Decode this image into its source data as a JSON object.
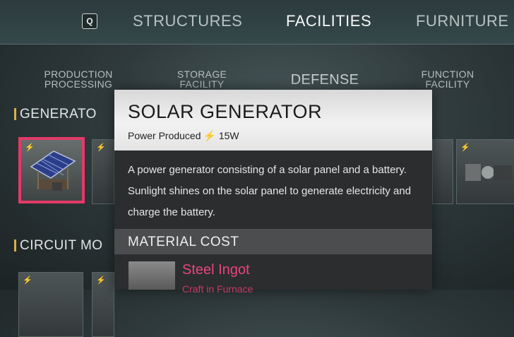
{
  "hotkey": "Q",
  "tabs": [
    {
      "label": "STRUCTURES"
    },
    {
      "label": "FACILITIES"
    },
    {
      "label": "FURNITURE"
    }
  ],
  "subtabs": [
    {
      "line1": "PRODUCTION",
      "line2": "PROCESSING"
    },
    {
      "line1": "STORAGE",
      "line2": "FACILITY"
    },
    {
      "label": "DEFENSE"
    },
    {
      "line1": "FUNCTION",
      "line2": "FACILITY"
    }
  ],
  "sections": {
    "generators": "GENERATO",
    "circuit": "CIRCUIT MO"
  },
  "popup": {
    "title": "SOLAR GENERATOR",
    "power_label": "Power Produced",
    "power_value": "15W",
    "description": "A power generator consisting of a solar panel and a battery. Sunlight shines on the solar panel to generate electricity and charge the battery.",
    "material_header": "MATERIAL COST",
    "material_name": "Steel Ingot",
    "material_source": "Craft in Furnace"
  },
  "colors": {
    "accent_selected": "#e33a67",
    "material_name": "#e8467a",
    "section_marker": "#d7b24a"
  }
}
